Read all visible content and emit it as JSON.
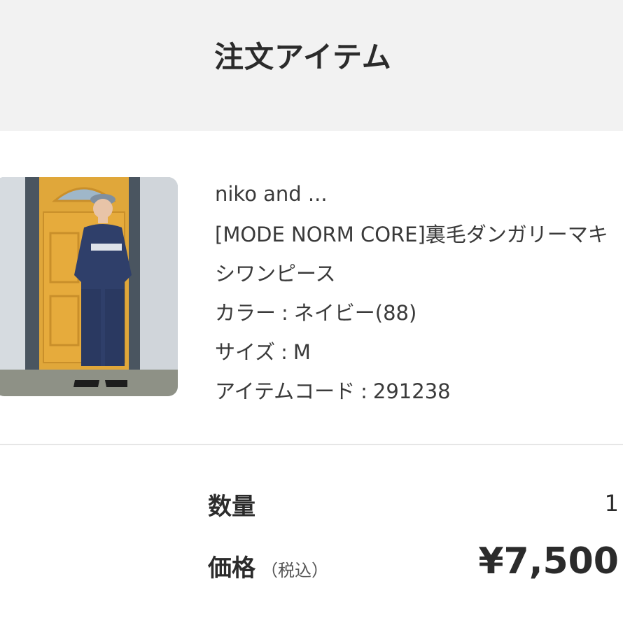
{
  "header": {
    "title": "注文アイテム"
  },
  "item": {
    "image_alt": "商品画像",
    "brand": "niko and ...",
    "name_line1": "[MODE NORM CORE]裏毛ダンガリーマキ",
    "name_line2": "シワンピース",
    "color_label": "カラー",
    "color_value": "ネイビー(88)",
    "size_label": "サイズ",
    "size_value": "M",
    "code_label": "アイテムコード",
    "code_value": "291238",
    "separator": ":"
  },
  "summary": {
    "quantity_label": "数量",
    "quantity_value": "1",
    "price_label": "価格",
    "price_note": "（税込）",
    "price_value": "¥7,500"
  }
}
